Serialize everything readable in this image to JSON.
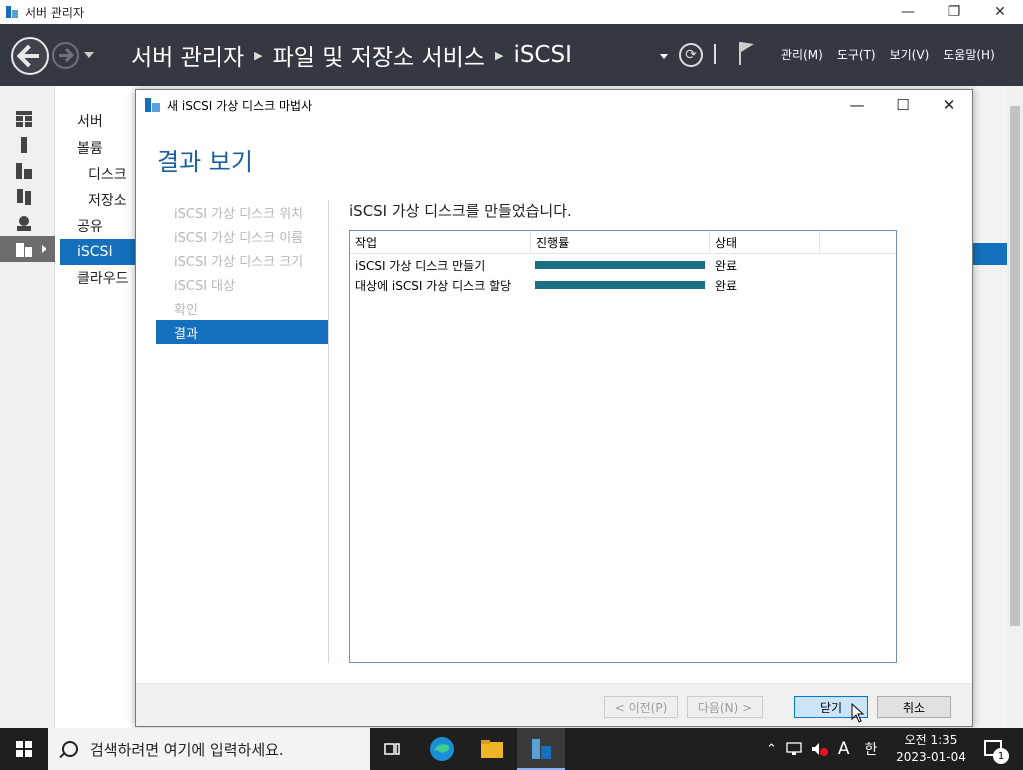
{
  "window": {
    "title": "서버 관리자",
    "minimize": "—",
    "maximize": "❐",
    "close": "✕"
  },
  "header": {
    "breadcrumb": [
      "서버 관리자",
      "파일 및 저장소 서비스",
      "iSCSI"
    ],
    "menu": [
      "관리(M)",
      "도구(T)",
      "보기(V)",
      "도움말(H)"
    ]
  },
  "nav": {
    "items": [
      {
        "label": "서버",
        "sub": false
      },
      {
        "label": "볼륨",
        "sub": false
      },
      {
        "label": "디스크",
        "sub": true
      },
      {
        "label": "저장소",
        "sub": true
      },
      {
        "label": "공유",
        "sub": false
      },
      {
        "label": "iSCSI",
        "sub": false,
        "active": true
      },
      {
        "label": "클라우드",
        "sub": false
      }
    ]
  },
  "dialog": {
    "title": "새 iSCSI 가상 디스크 마법사",
    "heading": "결과 보기",
    "steps": [
      "iSCSI 가상 디스크 위치",
      "iSCSI 가상 디스크 이름",
      "iSCSI 가상 디스크 크기",
      "iSCSI 대상",
      "확인",
      "결과"
    ],
    "active_step": 5,
    "result_message": "iSCSI 가상 디스크를 만들었습니다.",
    "columns": [
      "작업",
      "진행률",
      "상태"
    ],
    "rows": [
      {
        "task": "iSCSI 가상 디스크 만들기",
        "progress": 1.0,
        "status": "완료"
      },
      {
        "task": "대상에 iSCSI 가상 디스크 할당",
        "progress": 1.0,
        "status": "완료"
      }
    ],
    "buttons": {
      "prev": "< 이전(P)",
      "next": "다음(N) >",
      "close": "닫기",
      "cancel": "취소"
    }
  },
  "taskbar": {
    "search_placeholder": "검색하려면 여기에 입력하세요.",
    "ime_mode": "A",
    "ime_lang": "한",
    "time": "오전 1:35",
    "date": "2023-01-04",
    "notification_count": "1"
  },
  "colors": {
    "accent": "#1470bd",
    "header_bg": "#333841",
    "progress_fill": "#1a6f83",
    "heading": "#1d5f9e"
  }
}
